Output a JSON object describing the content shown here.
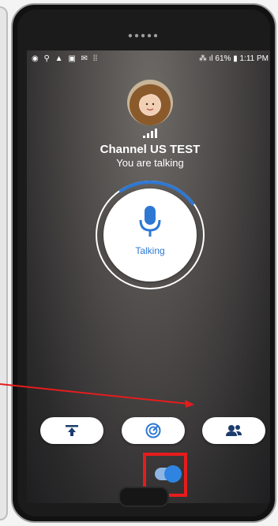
{
  "status_bar": {
    "left_icons": [
      "messenger-icon",
      "network-icon",
      "warning-icon",
      "gallery-icon",
      "mail-icon",
      "apps-icon"
    ],
    "battery": "61%",
    "time": "1:11 PM"
  },
  "channel": {
    "name": "Channel US TEST",
    "status": "You are talking"
  },
  "talk_button": {
    "label": "Talking"
  },
  "toolbar": {
    "buttons": [
      "upload-icon",
      "radar-icon",
      "contacts-icon"
    ]
  },
  "toggle": {
    "state": "on"
  },
  "colors": {
    "accent": "#2e78d4",
    "highlight": "#e61c1c"
  }
}
